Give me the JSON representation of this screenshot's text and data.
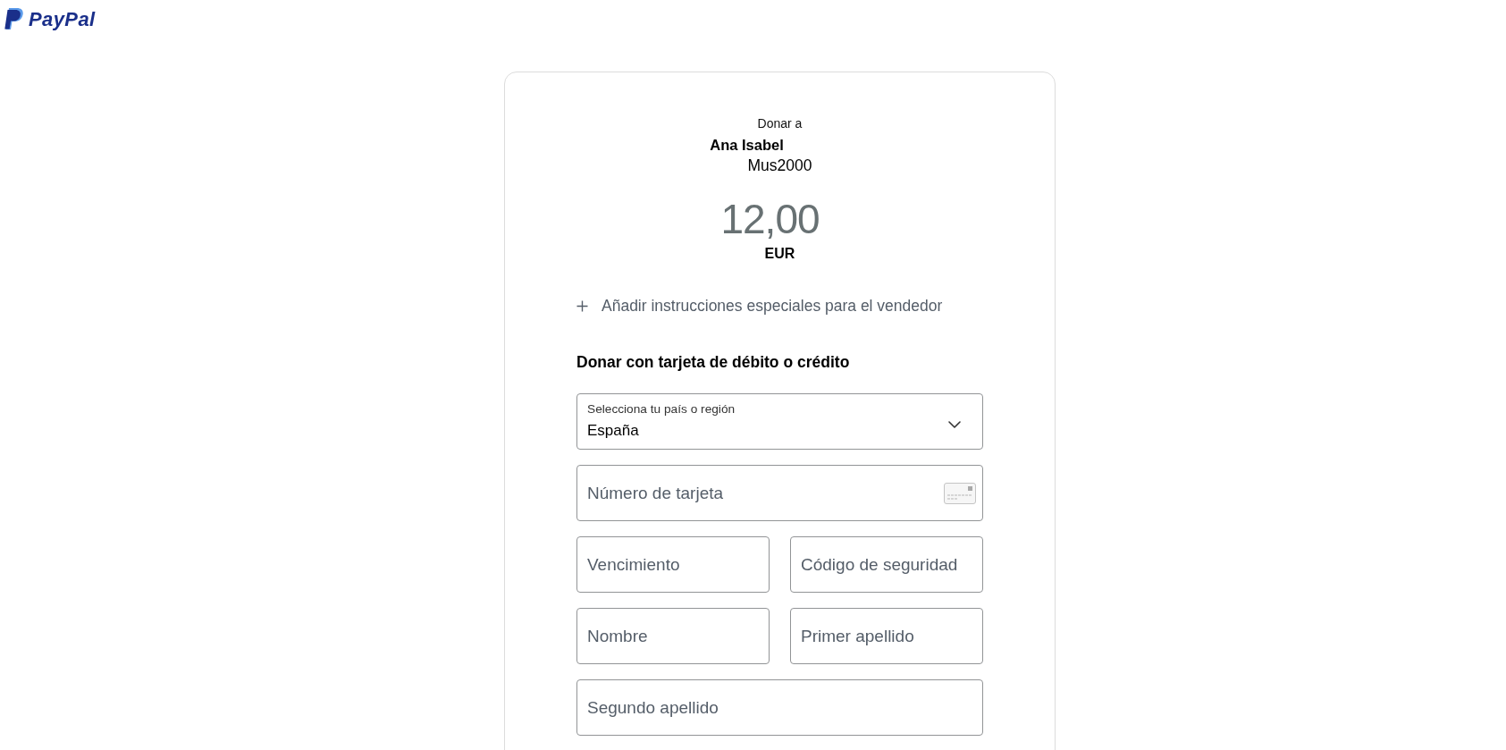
{
  "logo": {
    "text": "PayPal"
  },
  "recipient": {
    "label": "Donar a",
    "name": "Ana Isabel",
    "username": "Mus2000"
  },
  "amount": {
    "value": "12,00",
    "currency": "EUR"
  },
  "add_instructions": {
    "label": "Añadir instrucciones especiales para el vendedor"
  },
  "card_form": {
    "title": "Donar con tarjeta de débito o crédito",
    "rows": [
      [
        {
          "kind": "select",
          "label": "Selecciona tu país o región",
          "value": "España"
        }
      ],
      [
        {
          "kind": "card_number",
          "placeholder": "Número de tarjeta"
        }
      ],
      [
        {
          "kind": "text",
          "placeholder": "Vencimiento"
        },
        {
          "kind": "text",
          "placeholder": "Código de seguridad"
        }
      ],
      [
        {
          "kind": "text",
          "placeholder": "Nombre"
        },
        {
          "kind": "text",
          "placeholder": "Primer apellido"
        }
      ],
      [
        {
          "kind": "text",
          "placeholder": "Segundo apellido"
        }
      ]
    ]
  }
}
